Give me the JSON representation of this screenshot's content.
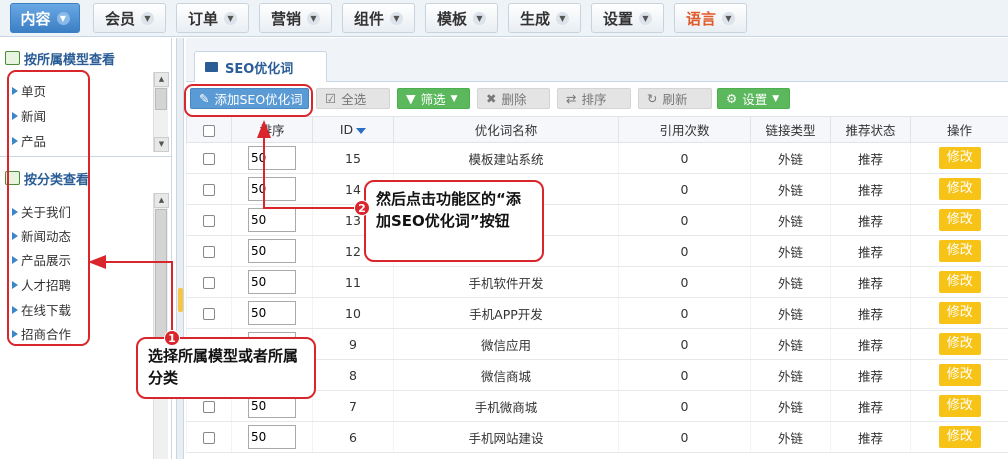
{
  "top_nav": [
    {
      "label": "内容",
      "active": true
    },
    {
      "label": "会员"
    },
    {
      "label": "订单"
    },
    {
      "label": "营销"
    },
    {
      "label": "组件"
    },
    {
      "label": "模板"
    },
    {
      "label": "生成"
    },
    {
      "label": "设置"
    },
    {
      "label": "语言",
      "accent": true
    }
  ],
  "sidebar": {
    "model_heading": "按所属模型查看",
    "models": [
      "单页",
      "新闻",
      "产品"
    ],
    "category_heading": "按分类查看",
    "categories": [
      "关于我们",
      "新闻动态",
      "产品展示",
      "人才招聘",
      "在线下载",
      "招商合作"
    ]
  },
  "tab": {
    "label": "SEO优化词"
  },
  "toolbar": {
    "add": "添加SEO优化词",
    "select_all": "全选",
    "filter": "筛选",
    "delete": "删除",
    "sort": "排序",
    "refresh": "刷新",
    "settings": "设置"
  },
  "table": {
    "headers": [
      "排序",
      "ID",
      "优化词名称",
      "引用次数",
      "链接类型",
      "推荐状态",
      "操作"
    ],
    "edit_label": "修改",
    "rows": [
      {
        "sort": "50",
        "id": "15",
        "name": "模板建站系统",
        "refs": "0",
        "link": "外链",
        "rec": "推荐"
      },
      {
        "sort": "50",
        "id": "14",
        "name": "",
        "refs": "0",
        "link": "外链",
        "rec": "推荐"
      },
      {
        "sort": "50",
        "id": "13",
        "name": "",
        "refs": "0",
        "link": "外链",
        "rec": "推荐"
      },
      {
        "sort": "50",
        "id": "12",
        "name": "",
        "refs": "0",
        "link": "外链",
        "rec": "推荐"
      },
      {
        "sort": "50",
        "id": "11",
        "name": "手机软件开发",
        "refs": "0",
        "link": "外链",
        "rec": "推荐"
      },
      {
        "sort": "50",
        "id": "10",
        "name": "手机APP开发",
        "refs": "0",
        "link": "外链",
        "rec": "推荐"
      },
      {
        "sort": "50",
        "id": "9",
        "name": "微信应用",
        "refs": "0",
        "link": "外链",
        "rec": "推荐"
      },
      {
        "sort": "50",
        "id": "8",
        "name": "微信商城",
        "refs": "0",
        "link": "外链",
        "rec": "推荐"
      },
      {
        "sort": "50",
        "id": "7",
        "name": "手机微商城",
        "refs": "0",
        "link": "外链",
        "rec": "推荐"
      },
      {
        "sort": "50",
        "id": "6",
        "name": "手机网站建设",
        "refs": "0",
        "link": "外链",
        "rec": "推荐"
      }
    ]
  },
  "annotations": {
    "step1_num": "1",
    "step1_text": "选择所属模型或者所属分类",
    "step2_num": "2",
    "step2_text": "然后点击功能区的“添加SEO优化词”按钮"
  }
}
